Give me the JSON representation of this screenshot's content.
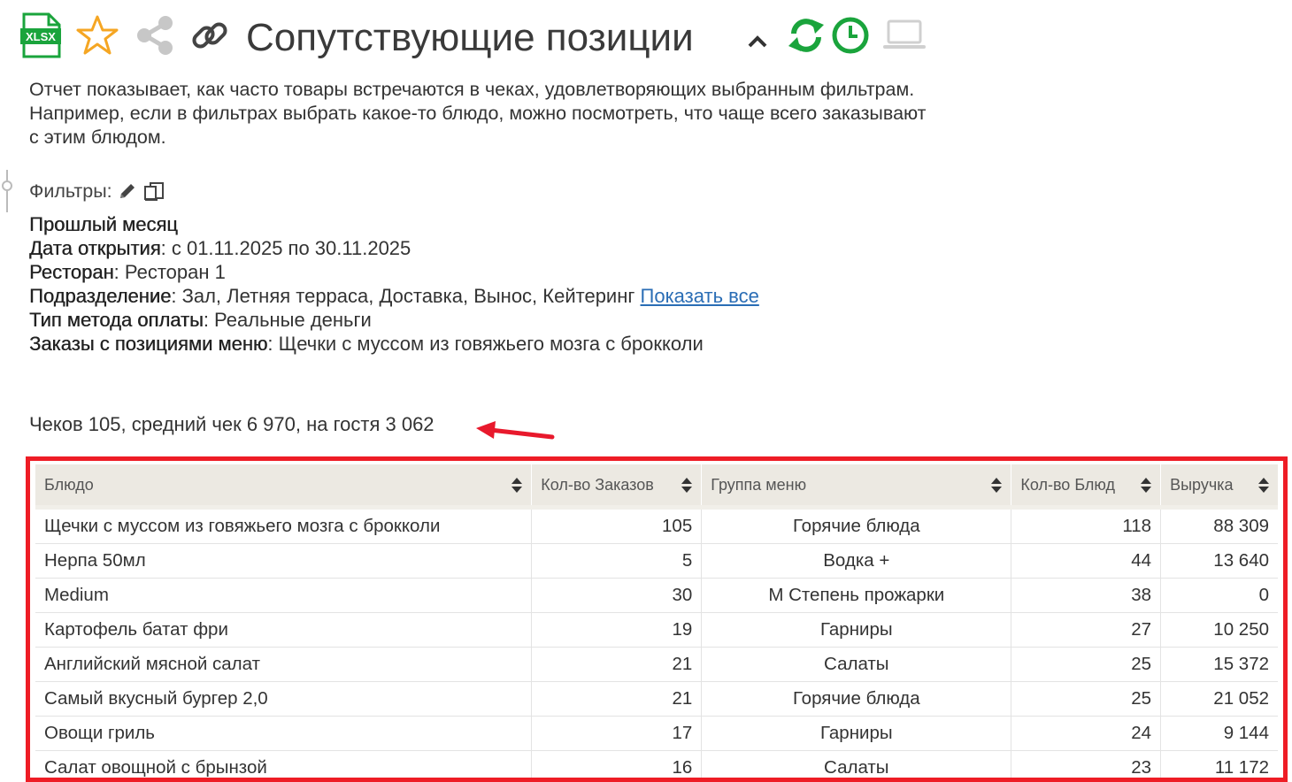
{
  "toolbar": {
    "xlsx_label": "XLSX",
    "title": "Сопутствующие позиции",
    "colors": {
      "green": "#1aa43c",
      "star": "#f5a623",
      "gray": "#c7c7c7"
    }
  },
  "description": [
    "Отчет показывает, как часто товары встречаются в чеках, удовлетворяющих выбранным фильтрам.",
    "Например, если в фильтрах выбрать какое-то блюдо, можно посмотреть, что чаще всего заказывают",
    "с этим блюдом."
  ],
  "filters": {
    "label": "Фильтры:",
    "period": "Прошлый месяц",
    "items": [
      {
        "key": "Дата открытия",
        "value": " с 01.11.2025 по 30.11.2025"
      },
      {
        "key": "Ресторан",
        "value": " Ресторан 1"
      },
      {
        "key": "Подразделение",
        "value": " Зал, Летняя терраса, Доставка, Вынос, Кейтеринг"
      },
      {
        "key": "Тип метода оплаты",
        "value": " Реальные деньги"
      },
      {
        "key": "Заказы с позициями меню",
        "value": " Щечки с муссом из говяжьего мозга с брокколи"
      }
    ],
    "show_all_link": "Показать все"
  },
  "summary": "Чеков 105, средний чек 6 970, на гостя 3 062",
  "table": {
    "headers": [
      "Блюдо",
      "Кол-во Заказов",
      "Группа меню",
      "Кол-во Блюд",
      "Выручка"
    ],
    "rows": [
      [
        "Щечки с муссом из говяжьего мозга с брокколи",
        "105",
        "Горячие блюда",
        "118",
        "88 309"
      ],
      [
        "Нерпа 50мл",
        "5",
        "Водка +",
        "44",
        "13 640"
      ],
      [
        "Medium",
        "30",
        "M Степень прожарки",
        "38",
        "0"
      ],
      [
        "Картофель батат фри",
        "19",
        "Гарниры",
        "27",
        "10 250"
      ],
      [
        "Английский мясной салат",
        "21",
        "Салаты",
        "25",
        "15 372"
      ],
      [
        "Самый вкусный бургер 2,0",
        "21",
        "Горячие блюда",
        "25",
        "21 052"
      ],
      [
        "Овощи гриль",
        "17",
        "Гарниры",
        "24",
        "9 144"
      ],
      [
        "Салат овощной с брынзой",
        "16",
        "Салаты",
        "23",
        "11 172"
      ]
    ]
  }
}
